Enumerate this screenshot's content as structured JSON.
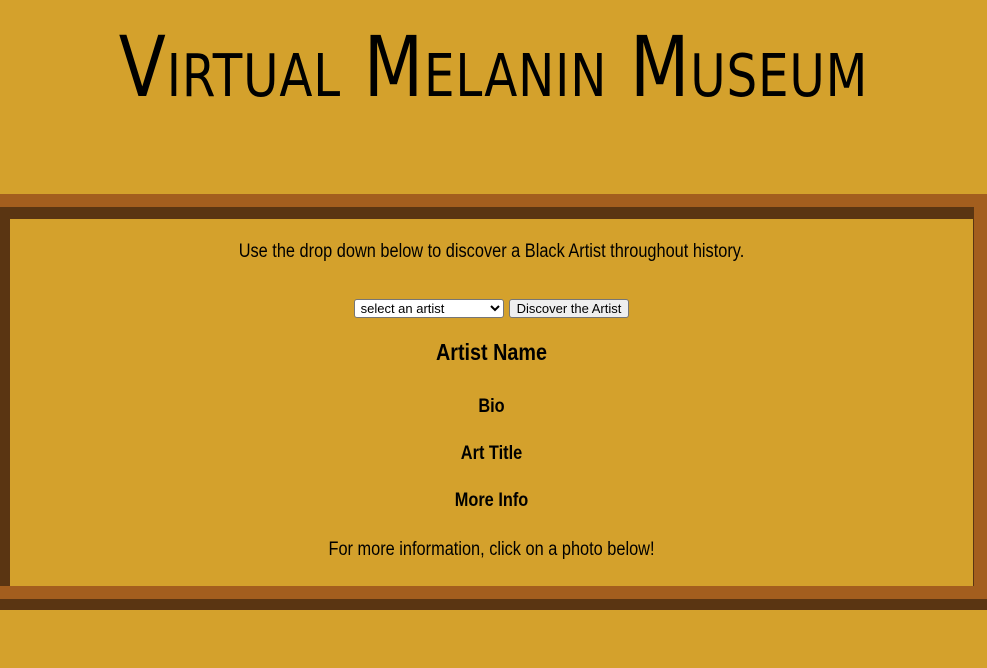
{
  "header": {
    "title": "Virtual Melanin Museum"
  },
  "main": {
    "intro_text": "Use the drop down below to discover a Black Artist throughout history.",
    "artist_select": {
      "selected": "select an artist",
      "options": [
        "select an artist"
      ]
    },
    "discover_button_label": "Discover the Artist",
    "artist_name_heading": "Artist Name",
    "bio_heading": "Bio",
    "art_title_heading": "Art Title",
    "more_info_heading": "More Info",
    "footer_text": "For more information, click on a photo below!"
  },
  "colors": {
    "background": "#d4a12c",
    "frame_dark": "#5a3512",
    "frame_light": "#a35e1e"
  }
}
